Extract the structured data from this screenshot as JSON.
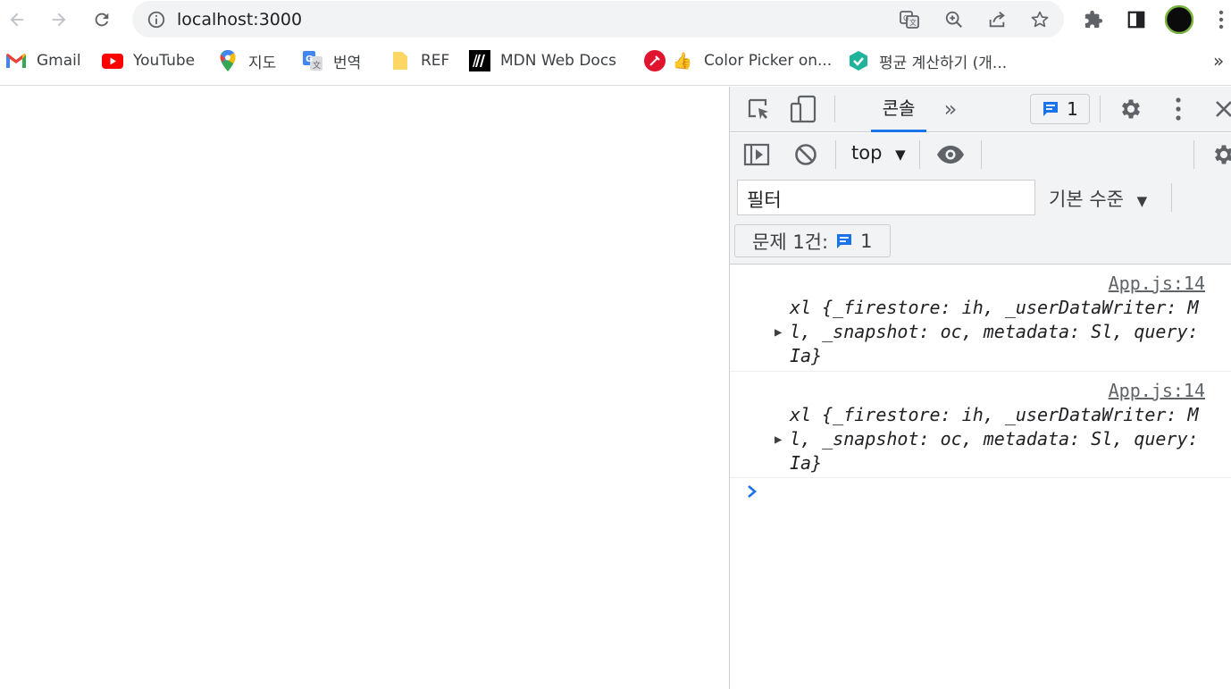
{
  "browser": {
    "url": "localhost:3000"
  },
  "bookmarks": [
    {
      "label": "Gmail",
      "icon": "gmail-icon"
    },
    {
      "label": "YouTube",
      "icon": "youtube-icon"
    },
    {
      "label": "지도",
      "icon": "maps-icon"
    },
    {
      "label": "번역",
      "icon": "translate-icon"
    },
    {
      "label": "REF",
      "icon": "folder-icon"
    },
    {
      "label": "MDN Web Docs",
      "icon": "mdn-icon"
    },
    {
      "label": "Color Picker on...",
      "icon": "color-picker-icon"
    },
    {
      "label": "평균 계산하기 (개...",
      "icon": "calc-icon"
    }
  ],
  "bookmarks_more": "»",
  "devtools": {
    "tab_console": "콘솔",
    "more_tabs": "»",
    "issues_count": "1",
    "context": "top",
    "filter_placeholder": "필터",
    "levels": "기본 수준",
    "issues_label": "문제 1건:",
    "issues_badge_count": "1",
    "messages": [
      {
        "source": "App.js:14",
        "line1": "xl {_firestore: ih, _userDataWriter: M",
        "line2": "l, _snapshot: oc, metadata: Sl, query:",
        "line3": "Ia}"
      },
      {
        "source": "App.js:14",
        "line1": "xl {_firestore: ih, _userDataWriter: M",
        "line2": "l, _snapshot: oc, metadata: Sl, query:",
        "line3": "Ia}"
      }
    ]
  },
  "colors": {
    "accent": "#1a73e8",
    "devtools_bg": "#f1f3f4"
  }
}
